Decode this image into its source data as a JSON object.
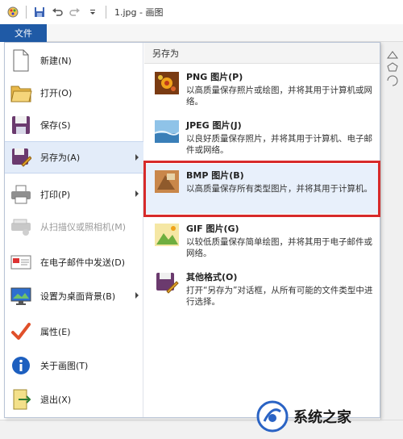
{
  "window": {
    "title": "1.jpg - 画图",
    "file_tab": "文件"
  },
  "menu": {
    "left_items": [
      {
        "label": "新建(N)",
        "icon": "new-file-icon"
      },
      {
        "label": "打开(O)",
        "icon": "folder-open-icon"
      },
      {
        "label": "保存(S)",
        "icon": "save-icon"
      },
      {
        "label": "另存为(A)",
        "icon": "save-as-icon",
        "selected": true,
        "has_submenu": true
      },
      {
        "label": "打印(P)",
        "icon": "printer-icon",
        "has_submenu": true
      },
      {
        "label": "从扫描仪或照相机(M)",
        "icon": "scanner-icon",
        "disabled": true
      },
      {
        "label": "在电子邮件中发送(D)",
        "icon": "email-icon"
      },
      {
        "label": "设置为桌面背景(B)",
        "icon": "desktop-icon",
        "has_submenu": true
      },
      {
        "label": "属性(E)",
        "icon": "checkmark-icon"
      },
      {
        "label": "关于画图(T)",
        "icon": "info-icon"
      },
      {
        "label": "退出(X)",
        "icon": "exit-icon"
      }
    ],
    "save_as": {
      "heading": "另存为",
      "items": [
        {
          "title": "PNG 图片(P)",
          "desc": "以高质量保存照片或绘图，并将其用于计算机或网络。",
          "icon": "png-image-icon"
        },
        {
          "title": "JPEG 图片(J)",
          "desc": "以良好质量保存照片，并将其用于计算机、电子邮件或网络。",
          "icon": "jpeg-image-icon"
        },
        {
          "title": "BMP 图片(B)",
          "desc": "以高质量保存所有类型图片，并将其用于计算机。",
          "icon": "bmp-image-icon",
          "highlighted": true
        },
        {
          "title": "GIF 图片(G)",
          "desc": "以较低质量保存简单绘图，并将其用于电子邮件或网络。",
          "icon": "gif-image-icon"
        },
        {
          "title": "其他格式(O)",
          "desc": "打开“另存为”对话框，从所有可能的文件类型中进行选择。",
          "icon": "other-format-icon"
        }
      ]
    }
  },
  "watermark": {
    "text": "系统之家"
  },
  "colors": {
    "accent": "#1f5aa6",
    "highlight_box": "#d72a2a",
    "selected_bg": "#e3ecf9"
  }
}
